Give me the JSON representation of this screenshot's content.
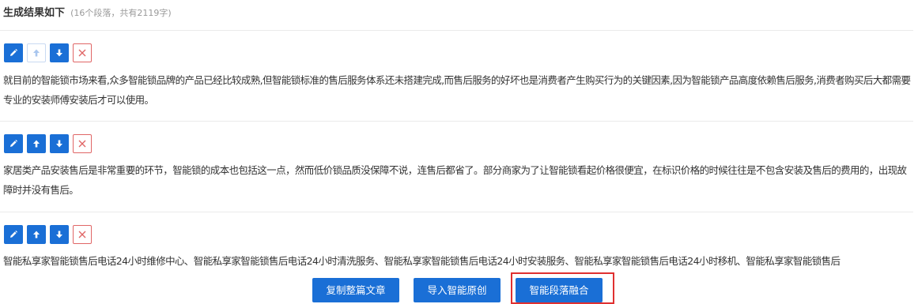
{
  "header": {
    "title": "生成结果如下",
    "meta": "(16个段落，共有2119字)"
  },
  "paragraphs": [
    {
      "text": "就目前的智能锁市场来看,众多智能锁品牌的产品已经比较成熟,但智能锁标准的售后服务体系还未搭建完成,而售后服务的好坏也是消费者产生购买行为的关键因素,因为智能锁产品高度依赖售后服务,消费者购买后大都需要专业的安装师傅安装后才可以使用。",
      "move_up_disabled": true
    },
    {
      "text": "家居类产品安装售后是非常重要的环节，智能锁的成本也包括这一点，然而低价锁品质没保障不说，连售后都省了。部分商家为了让智能锁看起价格很便宜，在标识价格的时候往往是不包含安装及售后的费用的，出现故障时并没有售后。",
      "move_up_disabled": false
    },
    {
      "text": "智能私享家智能锁售后电话24小时维修中心、智能私享家智能锁售后电话24小时清洗服务、智能私享家智能锁售后电话24小时安装服务、智能私享家智能锁售后电话24小时移机、智能私享家智能锁售后",
      "move_up_disabled": false
    }
  ],
  "actions": {
    "copy_label": "复制整篇文章",
    "import_label": "导入智能原创",
    "merge_label": "智能段落融合"
  },
  "colors": {
    "primary": "#1a6fd6",
    "delete": "#e06666",
    "highlight": "#e03030"
  }
}
